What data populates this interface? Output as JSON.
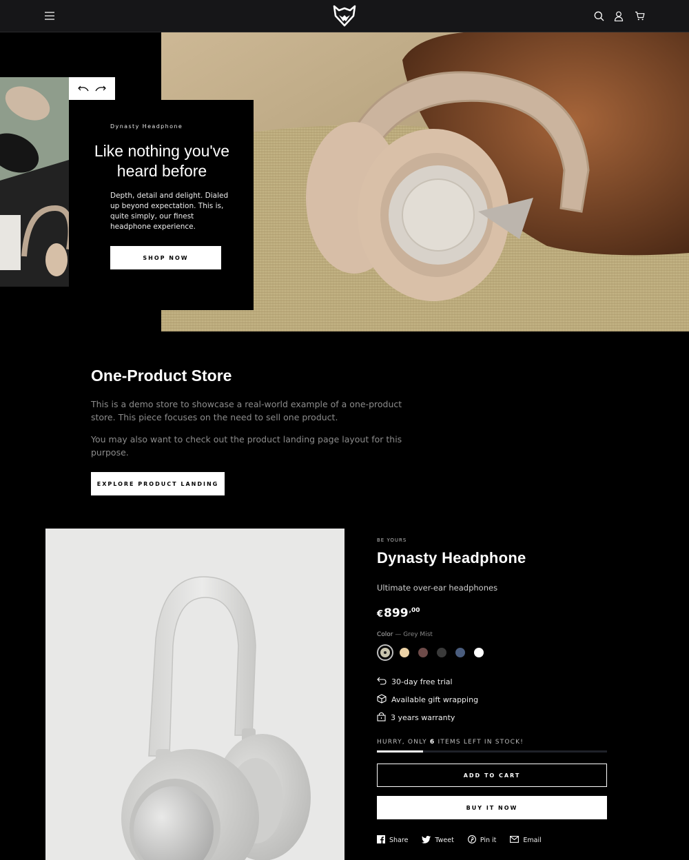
{
  "header": {
    "menu_icon": "hamburger-icon",
    "logo_icon": "fox-logo-icon",
    "search_icon": "search-icon",
    "account_icon": "user-icon",
    "cart_icon": "cart-icon"
  },
  "hero": {
    "subtitle": "Dynasty Headphone",
    "title": "Like nothing you've heard before",
    "text": "Depth, detail and delight. Dialed up beyond expectation. This is, quite simply, our finest headphone experience.",
    "button": "SHOP NOW"
  },
  "intro": {
    "title": "One-Product Store",
    "p1": "This is a demo store to showcase a real-world example of a one-product store. This piece focuses on the need to sell one product.",
    "p2": "You may also want to check out the product landing page layout for this purpose.",
    "button": "EXPLORE PRODUCT LANDING"
  },
  "product": {
    "eyebrow": "BE YOURS",
    "title": "Dynasty Headphone",
    "subtitle": "Ultimate over-ear headphones",
    "price_currency": "€",
    "price_main": "899",
    "price_cents": ",00",
    "color_label": "Color",
    "color_value": "— Grey Mist",
    "swatches": [
      "#c9c5ae",
      "#ecd2a6",
      "#6e4b49",
      "#3a3a3a",
      "#4a5d7e",
      "#ffffff"
    ],
    "features": {
      "trial": "30-day free trial",
      "gift": "Available gift wrapping",
      "warranty": "3 years warranty"
    },
    "stock_pre": "HURRY, ONLY",
    "stock_count": "6",
    "stock_post": "ITEMS LEFT IN STOCK!",
    "stock_fraction": 0.2,
    "add_to_cart": "ADD TO CART",
    "buy_now": "BUY IT NOW"
  },
  "share": {
    "facebook": "Share",
    "twitter": "Tweet",
    "pinterest": "Pin it",
    "email": "Email"
  }
}
